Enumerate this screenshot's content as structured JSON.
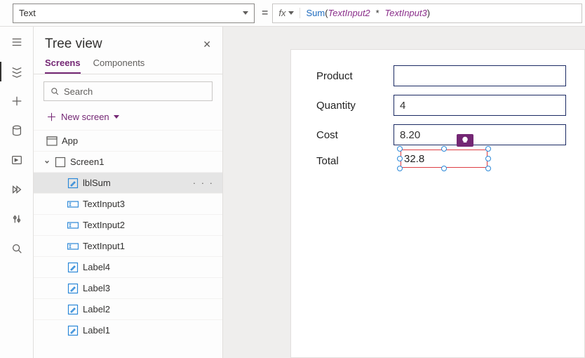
{
  "topbar": {
    "property": "Text",
    "fx_label": "fx",
    "formula": {
      "fn": "Sum",
      "a": "TextInput2",
      "b": "TextInput3"
    }
  },
  "tree": {
    "title": "Tree view",
    "tabs": {
      "screens": "Screens",
      "components": "Components"
    },
    "search_placeholder": "Search",
    "new_screen": "New screen",
    "app": "App",
    "screen1": "Screen1",
    "items": [
      {
        "key": "lblSum",
        "label": "lblSum",
        "type": "label",
        "selected": true
      },
      {
        "key": "TextInput3",
        "label": "TextInput3",
        "type": "input"
      },
      {
        "key": "TextInput2",
        "label": "TextInput2",
        "type": "input"
      },
      {
        "key": "TextInput1",
        "label": "TextInput1",
        "type": "input"
      },
      {
        "key": "Label4",
        "label": "Label4",
        "type": "label"
      },
      {
        "key": "Label3",
        "label": "Label3",
        "type": "label"
      },
      {
        "key": "Label2",
        "label": "Label2",
        "type": "label"
      },
      {
        "key": "Label1",
        "label": "Label1",
        "type": "label"
      }
    ]
  },
  "canvas": {
    "rows": {
      "product": {
        "label": "Product",
        "value": ""
      },
      "quantity": {
        "label": "Quantity",
        "value": "4"
      },
      "cost": {
        "label": "Cost",
        "value": "8.20"
      },
      "total": {
        "label": "Total",
        "value": "32.8"
      }
    }
  }
}
